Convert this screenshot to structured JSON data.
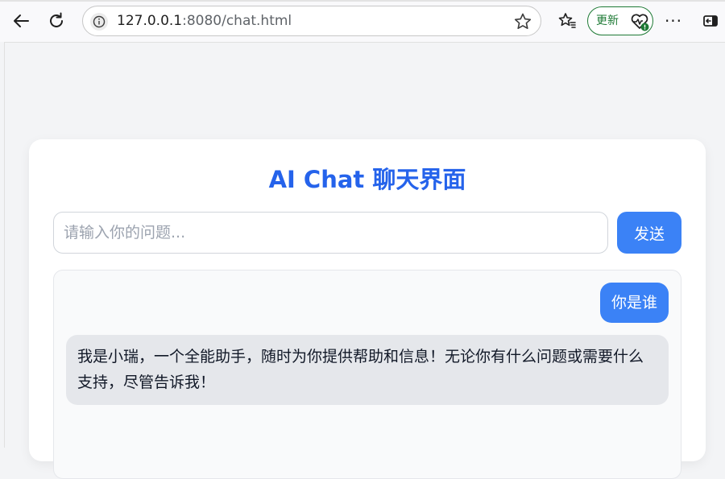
{
  "browser": {
    "url_host": "127.0.0.1",
    "url_rest": ":8080/chat.html",
    "update_label": "更新",
    "more_label": "···",
    "icons": {
      "back": "arrow-left-icon",
      "reload": "reload-icon",
      "site_info": "info-icon",
      "bookmark": "star-icon",
      "favorites": "favorites-icon",
      "browser_essentials": "heart-pulse-icon",
      "more": "more-dots-icon",
      "sidebar": "sidebar-icon"
    }
  },
  "page": {
    "title": "AI Chat 聊天界面",
    "input_placeholder": "请输入你的问题...",
    "input_value": "",
    "send_label": "发送",
    "messages": [
      {
        "role": "user",
        "text": "你是谁"
      },
      {
        "role": "assistant",
        "text": "我是小瑞，一个全能助手，随时为你提供帮助和信息！无论你有什么问题或需要什么支持，尽管告诉我！"
      }
    ]
  },
  "colors": {
    "accent": "#2563eb",
    "button": "#3b82f6",
    "assistant_bubble": "#e5e7eb",
    "update_green": "#1e7a35"
  }
}
